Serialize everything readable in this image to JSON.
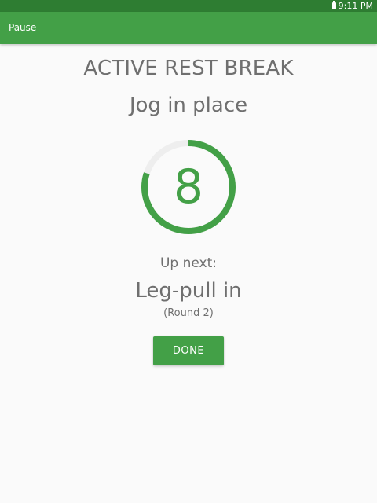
{
  "status_bar": {
    "time": "9:11 PM",
    "battery_icon": "battery-icon"
  },
  "app_bar": {
    "pause_label": "Pause"
  },
  "workout": {
    "title": "ACTIVE REST BREAK",
    "exercise": "Jog in place",
    "timer_value": "8",
    "timer_progress": 0.8,
    "up_next_label": "Up next:",
    "next_exercise": "Leg-pull in",
    "next_round": "(Round 2)",
    "done_label": "DONE"
  },
  "colors": {
    "status_bar": "#2e7d32",
    "app_bar": "#43a047",
    "accent": "#43a047",
    "ring_track": "#eeeeee",
    "text": "#6f6f6f",
    "background": "#fafafa"
  }
}
